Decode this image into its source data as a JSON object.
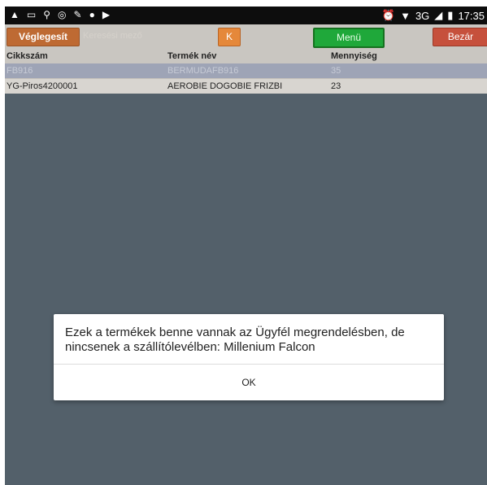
{
  "statusbar": {
    "icons_left": [
      "warning-icon",
      "image-icon",
      "usb-icon",
      "lifebuoy-icon",
      "wrench-icon",
      "location-icon",
      "play-icon"
    ],
    "network": "3G",
    "time": "17:35"
  },
  "toolbar": {
    "finalize_label": "Véglegesít",
    "search_placeholder": "Keresési mező",
    "k_label": "K",
    "menu_label": "Menü",
    "close_label": "Bezár"
  },
  "table": {
    "columns": [
      "Cikkszám",
      "Termék név",
      "Mennyiség"
    ],
    "rows": [
      {
        "sku": "FB916",
        "name": "BERMUDAFB916",
        "qty": "35"
      },
      {
        "sku": "YG-Piros4200001",
        "name": "AEROBIE DOGOBIE FRIZBI",
        "qty": "23"
      }
    ]
  },
  "dialog": {
    "message": "Ezek a termékek benne vannak az Ügyfél megrendelésben, de nincsenek a szállítólevélben:  Millenium Falcon",
    "ok_label": "OK"
  }
}
